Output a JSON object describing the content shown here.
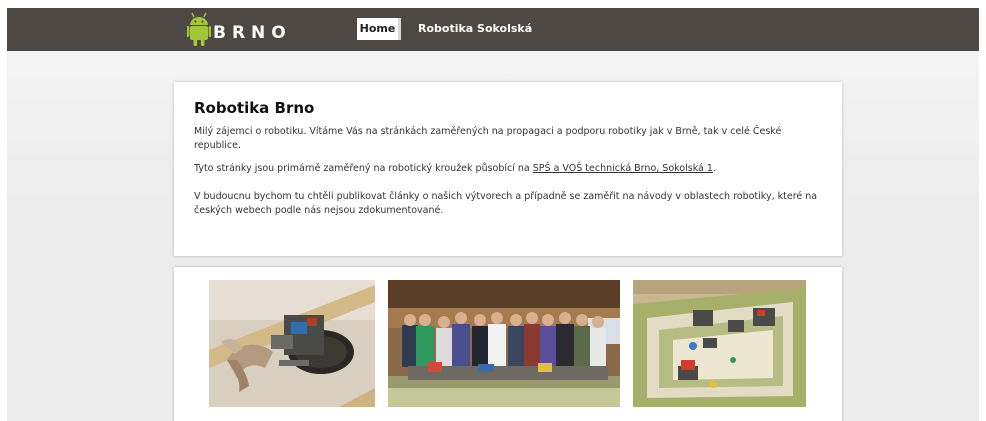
{
  "header": {
    "logo_text": "BRNO",
    "nav": [
      {
        "label": "Home",
        "active": true
      },
      {
        "label": "Robotika Sokolská",
        "active": false
      }
    ]
  },
  "intro": {
    "title": "Robotika Brno",
    "p1": "Milý zájemci o robotiku. Vítáme Vás na stránkách zaměřených na propagaci a podporu robotiky jak v Brně, tak v celé České republice.",
    "p2_before": "Tyto stránky jsou primárně zaměřený na robotický kroužek působící na ",
    "p2_link": "SPŠ a VOŠ technická Brno, Sokolská 1",
    "p2_after": ".",
    "p3": "V budoucnu bychom tu chtěli publikovat články o našich výtvorech a případně se zaměřit na návody v oblastech robotiky, které na českých webech podle nás nejsou zdokumentované."
  },
  "colors": {
    "header_bg": "#4e4844",
    "android_green": "#a4c639"
  },
  "gallery": [
    {
      "name": "photo-robot-closeup"
    },
    {
      "name": "photo-team-group"
    },
    {
      "name": "photo-robot-arena"
    }
  ]
}
